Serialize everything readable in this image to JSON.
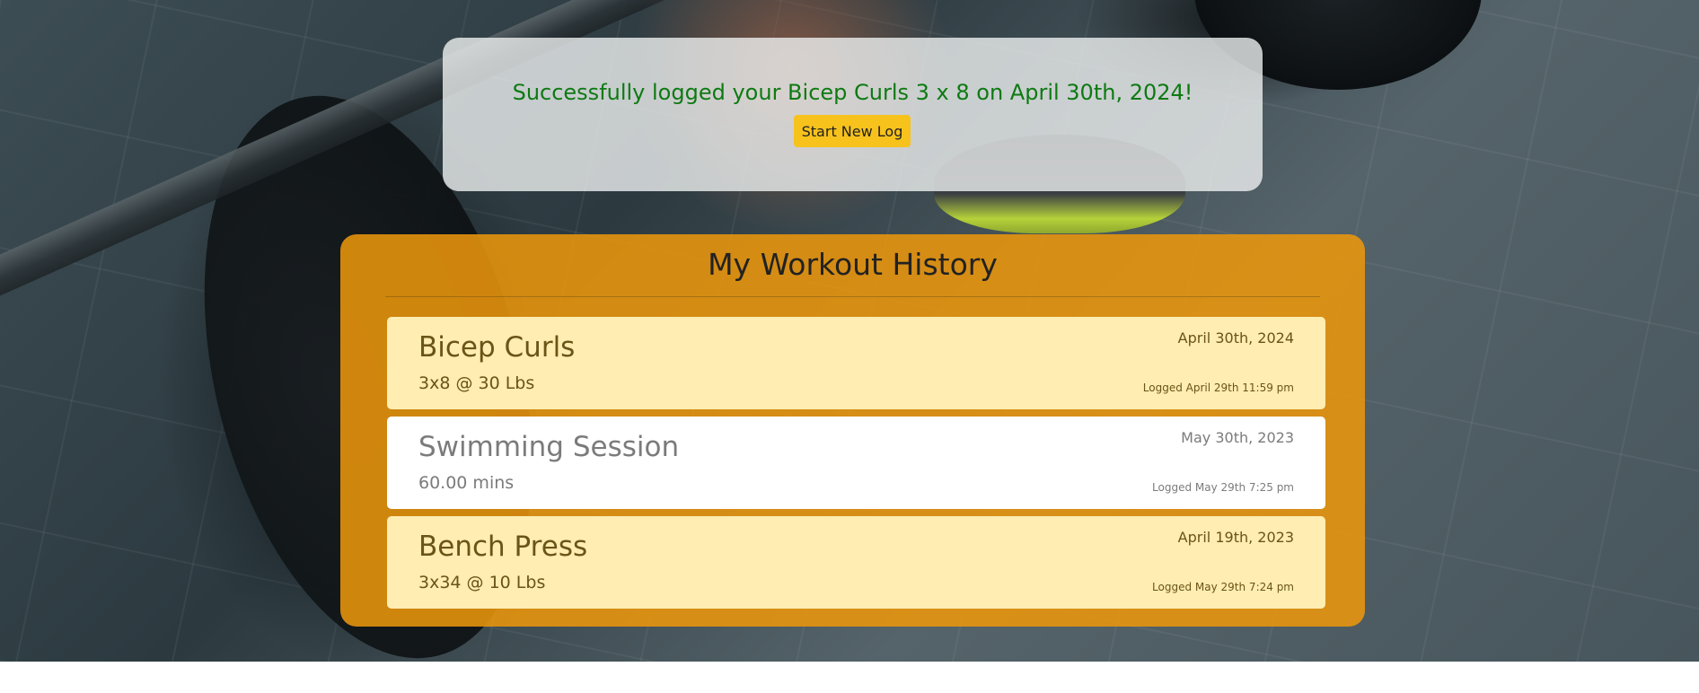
{
  "banner": {
    "message": "Successfully logged your Bicep Curls 3 x 8 on April 30th, 2024!",
    "button_label": "Start New Log"
  },
  "history": {
    "title": "My Workout History",
    "entries": [
      {
        "name": "Bicep Curls",
        "detail": "3x8 @ 30 Lbs",
        "date": "April 30th, 2024",
        "logged": "Logged April 29th 11:59 pm",
        "kind": "weights"
      },
      {
        "name": "Swimming Session",
        "detail": "60.00 mins",
        "date": "May 30th, 2023",
        "logged": "Logged May 29th 7:25 pm",
        "kind": "cardio"
      },
      {
        "name": "Bench Press",
        "detail": "3x34 @ 10 Lbs",
        "date": "April 19th, 2023",
        "logged": "Logged May 29th 7:24 pm",
        "kind": "weights"
      }
    ]
  },
  "colors": {
    "success_text": "#0d7a12",
    "button": "#f7c21c",
    "history_panel": "#ec960c",
    "weights_card": "#ffedb2",
    "cardio_card": "#ffffff"
  }
}
